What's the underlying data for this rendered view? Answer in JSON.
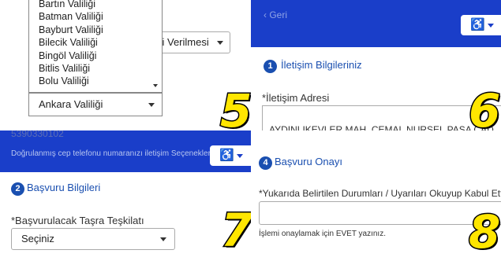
{
  "panel5": {
    "behind_select_text": "si Verilmesi",
    "dropdown_options": [
      "Bartın Valiliği",
      "Batman Valiliği",
      "Bayburt Valiliği",
      "Bilecik Valiliği",
      "Bingöl Valiliği",
      "Bitlis Valiliği",
      "Bolu Valiliği"
    ],
    "selected_value": "Ankara Valiliği",
    "badge": "5"
  },
  "panel6": {
    "back_label": "Geri",
    "accessibility_icon": "wheelchair-icon",
    "step_number": "1",
    "step_label": "İletişim Bilgileriniz",
    "field_label": "*İletişim Adresi",
    "field_value": "AYDINLIKEVLER MAH. CEMAL NURSEL PAŞA CAD.",
    "badge": "6"
  },
  "panel7": {
    "phone_remnant": "5390330102",
    "hint": "Doğrulanmış cep telefonu numaranızı iletişim Seçenekleri",
    "accessibility_icon": "wheelchair-icon",
    "step_number": "2",
    "step_label": "Başvuru Bilgileri",
    "field_label": "*Başvurulacak Taşra Teşkilatı",
    "select_value": "Seçiniz",
    "badge": "7"
  },
  "panel8": {
    "step_number": "4",
    "step_label": "Başvuru Onayı",
    "field_label": "*Yukarıda Belirtilen Durumları / Uyarıları Okuyup Kabul Ettiğ",
    "input_value": "",
    "help_text": "İşlemi onaylamak için EVET yazınız.",
    "badge": "8"
  },
  "colors": {
    "brand_blue": "#1a3ec9",
    "step_blue": "#1a4fb0",
    "badge_yellow": "#ffe600"
  }
}
